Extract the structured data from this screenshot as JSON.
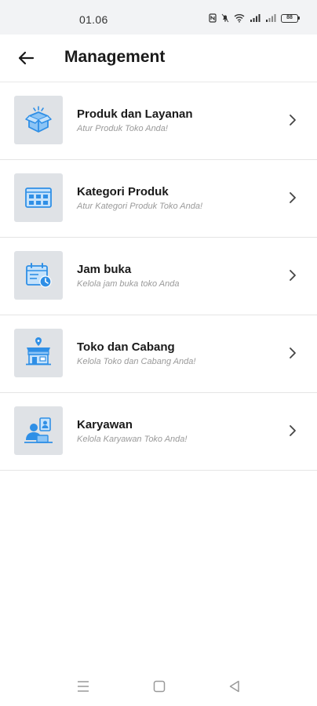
{
  "status_bar": {
    "time": "01.06",
    "battery": "88"
  },
  "header": {
    "title": "Management",
    "back_icon": "arrow-left-icon"
  },
  "menu": {
    "items": [
      {
        "title": "Produk dan Layanan",
        "subtitle": "Atur Produk Toko Anda!",
        "icon": "product-box-icon"
      },
      {
        "title": "Kategori Produk",
        "subtitle": "Atur Kategori Produk Toko Anda!",
        "icon": "category-grid-icon"
      },
      {
        "title": "Jam buka",
        "subtitle": "Kelola jam buka toko Anda",
        "icon": "calendar-clock-icon"
      },
      {
        "title": "Toko dan Cabang",
        "subtitle": "Kelola Toko dan Cabang Anda!",
        "icon": "store-icon"
      },
      {
        "title": "Karyawan",
        "subtitle": "Kelola Karyawan Toko Anda!",
        "icon": "employee-icon"
      }
    ]
  },
  "colors": {
    "icon_blue": "#2f8fe6",
    "icon_bg": "#dfe2e6",
    "subtitle": "#9a9a9a"
  }
}
